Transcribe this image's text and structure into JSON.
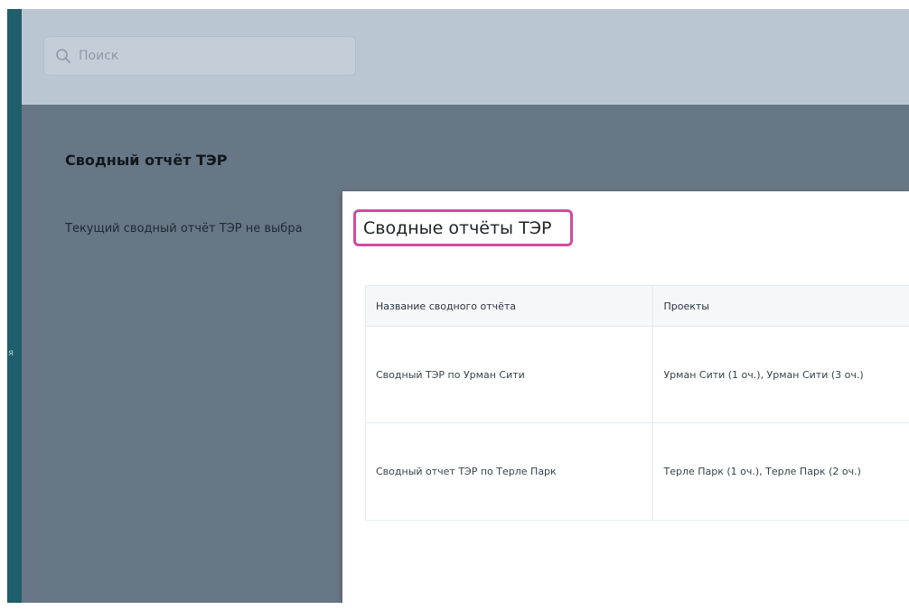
{
  "search": {
    "placeholder": "Поиск"
  },
  "page": {
    "title": "Сводный отчёт ТЭР",
    "subtitle": "Текущий сводный отчёт ТЭР не выбра"
  },
  "sidebar": {
    "fragments": [
      "я"
    ]
  },
  "modal": {
    "title": "Сводные отчёты ТЭР",
    "highlight_color": "#d44a9f",
    "table": {
      "headers": [
        "Название сводного отчёта",
        "Проекты"
      ],
      "rows": [
        [
          "Сводный ТЭР по Урман Сити",
          "Урман Сити (1 оч.), Урман Сити (3 оч.)"
        ],
        [
          "Сводный отчет ТЭР по Терле Парк",
          "Терле Парк (1 оч.), Терле Парк (2 оч.)"
        ]
      ]
    }
  },
  "colors": {
    "sidebar": "#1f5e6a",
    "topbar": "#bac6d1",
    "overlay": "#687785"
  },
  "icons": {
    "search": "search-icon"
  }
}
